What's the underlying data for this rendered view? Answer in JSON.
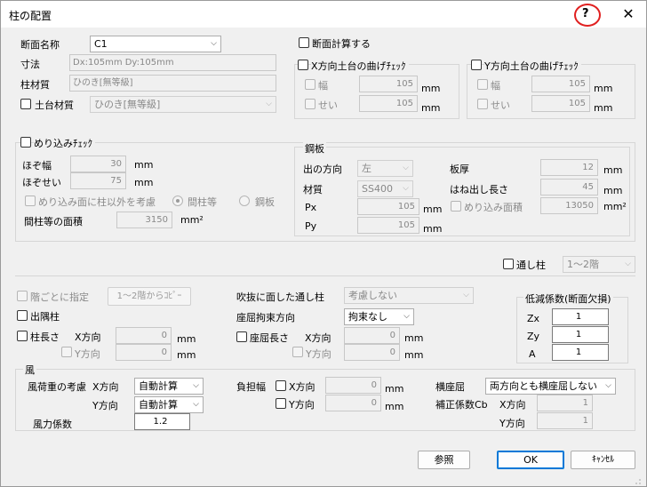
{
  "window": {
    "title": "柱の配置",
    "help": "?",
    "close": "✕"
  },
  "section": {
    "name_label": "断面名称",
    "name_value": "C1",
    "size_label": "寸法",
    "size_value": "Dx:105mm  Dy:105mm",
    "material_label": "柱材質",
    "material_value": "ひのき[無等級]",
    "base_material_label": "土台材質",
    "base_material_value": "ひのき[無等級]"
  },
  "calc": {
    "calc_label": "断面計算する",
    "x_group": "X方向土台の曲げﾁｪｯｸ",
    "y_group": "Y方向土台の曲げﾁｪｯｸ",
    "width_label": "幅",
    "height_label": "せい",
    "x_width": "105",
    "x_height": "105",
    "y_width": "105",
    "y_height": "105",
    "unit": "mm"
  },
  "embed": {
    "group_label": "めり込みﾁｪｯｸ",
    "tenon_width_label": "ほぞ幅",
    "tenon_width": "30",
    "tenon_height_label": "ほぞせい",
    "tenon_height": "75",
    "consider_label": "めり込み面に柱以外を考慮",
    "radio1": "間柱等",
    "radio2": "鋼板",
    "area_label": "間柱等の面積",
    "area_value": "3150",
    "area_unit": "mm²",
    "unit": "mm"
  },
  "steel": {
    "group_label": "鋼板",
    "dir_label": "出の方向",
    "dir_value": "左",
    "mat_label": "材質",
    "mat_value": "SS400",
    "px_label": "Px",
    "px_value": "105",
    "py_label": "Py",
    "py_value": "105",
    "thick_label": "板厚",
    "thick_value": "12",
    "protrude_label": "はね出し長さ",
    "protrude_value": "45",
    "embed_area_label": "めり込み面積",
    "embed_area_value": "13050",
    "unit": "mm",
    "area_unit": "mm²"
  },
  "through": {
    "label": "通し柱",
    "value": "1〜2階"
  },
  "floors": {
    "per_floor_label": "階ごとに指定",
    "copy_button": "1〜2階からｺﾋﾟｰ",
    "corner_label": "出隅柱",
    "length_label": "柱長さ",
    "x_dir": "X方向",
    "y_dir": "Y方向",
    "len_x": "0",
    "len_y": "0",
    "unit": "mm"
  },
  "atrium": {
    "label": "吹抜に面した通し柱",
    "value": "考慮しない",
    "restraint_label": "座屈拘束方向",
    "restraint_value": "拘束なし",
    "buckle_len_label": "座屈長さ",
    "x_dir": "X方向",
    "y_dir": "Y方向",
    "len_x": "0",
    "len_y": "0",
    "unit": "mm"
  },
  "reduction": {
    "group_label": "低減係数(断面欠損)",
    "zx_label": "Zx",
    "zx": "1",
    "zy_label": "Zy",
    "zy": "1",
    "a_label": "A",
    "a": "1"
  },
  "wind": {
    "group_label": "風",
    "consider_label": "風荷重の考慮",
    "x_dir": "X方向",
    "y_dir": "Y方向",
    "x_value": "自動計算",
    "y_value": "自動計算",
    "coef_label": "風力係数",
    "coef_value": "1.2",
    "bearing_label": "負担幅",
    "bear_x": "0",
    "bear_y": "0",
    "unit": "mm",
    "lat_label": "横座屈",
    "lat_value": "両方向とも横座屈しない",
    "cb_label": "補正係数Cb",
    "cb_x": "1",
    "cb_y": "1"
  },
  "buttons": {
    "ref": "参照",
    "ok": "OK",
    "cancel": "ｷｬﾝｾﾙ"
  }
}
